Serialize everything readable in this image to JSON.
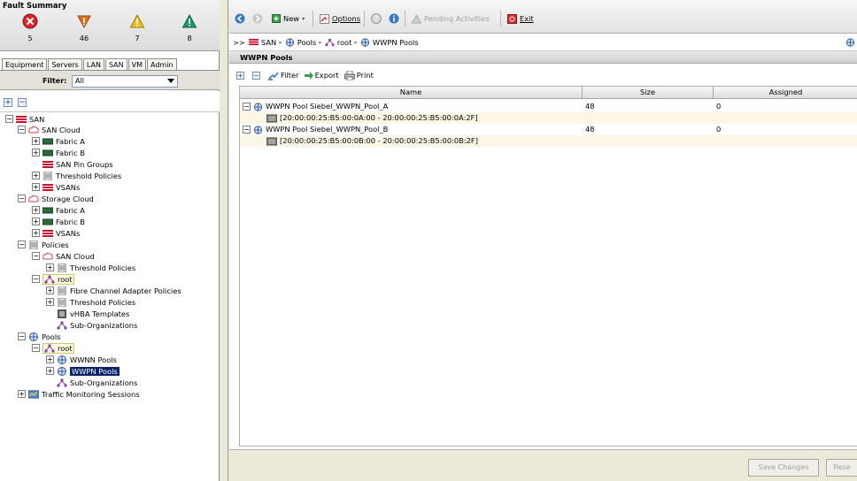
{
  "fault_summary": {
    "title": "Fault Summary",
    "items": [
      {
        "icon": "critical-icon",
        "count": "5",
        "color": "#d9262b"
      },
      {
        "icon": "major-icon",
        "count": "46",
        "color": "#e36f1e"
      },
      {
        "icon": "minor-icon",
        "count": "7",
        "color": "#f0c020"
      },
      {
        "icon": "warning-icon",
        "count": "8",
        "color": "#1c9a6c"
      }
    ]
  },
  "nav_tabs": [
    "Equipment",
    "Servers",
    "LAN",
    "SAN",
    "VM",
    "Admin"
  ],
  "active_tab": "SAN",
  "filter": {
    "label": "Filter:",
    "value": "All"
  },
  "tree": {
    "san": "SAN",
    "san_cloud": "SAN Cloud",
    "san_cloud_fabric_a": "Fabric A",
    "san_cloud_fabric_b": "Fabric B",
    "san_pin_groups": "SAN Pin Groups",
    "threshold_policies_1": "Threshold Policies",
    "vsans_1": "VSANs",
    "storage_cloud": "Storage Cloud",
    "storage_fabric_a": "Fabric A",
    "storage_fabric_b": "Fabric B",
    "vsans_2": "VSANs",
    "policies": "Policies",
    "policies_san_cloud": "SAN Cloud",
    "threshold_policies_2": "Threshold Policies",
    "policies_root": "root",
    "fc_adapter_policies": "Fibre Channel Adapter Policies",
    "threshold_policies_3": "Threshold Policies",
    "vhba_templates": "vHBA Templates",
    "sub_orgs_1": "Sub-Organizations",
    "pools": "Pools",
    "pools_root": "root",
    "wwnn_pools": "WWNN Pools",
    "wwpn_pools": "WWPN Pools",
    "sub_orgs_2": "Sub-Organizations",
    "traffic_monitoring": "Traffic Monitoring Sessions"
  },
  "toolbar": {
    "new_label": "New",
    "options_label": "Options",
    "pending_label": "Pending Activities",
    "exit_label": "Exit"
  },
  "breadcrumb": {
    "prefix": ">>",
    "items": [
      "SAN",
      "Pools",
      "root",
      "WWPN Pools"
    ]
  },
  "panel_title": "WWPN Pools",
  "table_tools": {
    "filter": "Filter",
    "export": "Export",
    "print": "Print"
  },
  "table": {
    "columns": [
      "Name",
      "Size",
      "Assigned"
    ],
    "rows": [
      {
        "name": "WWPN Pool Siebel_WWPN_Pool_A",
        "size": "48",
        "assigned": "0"
      },
      {
        "name": "[20:00:00:25:B5:00:0A:00 - 20:00:00:25:B5:00:0A:2F]",
        "size": "",
        "assigned": ""
      },
      {
        "name": "WWPN Pool Siebel_WWPN_Pool_B",
        "size": "48",
        "assigned": "0"
      },
      {
        "name": "[20:00:00:25:B5:00:0B:00 - 20:00:00:25:B5:00:0B:2F]",
        "size": "",
        "assigned": ""
      }
    ]
  },
  "footer": {
    "save_label": "Save Changes",
    "reset_label": "Rese"
  }
}
